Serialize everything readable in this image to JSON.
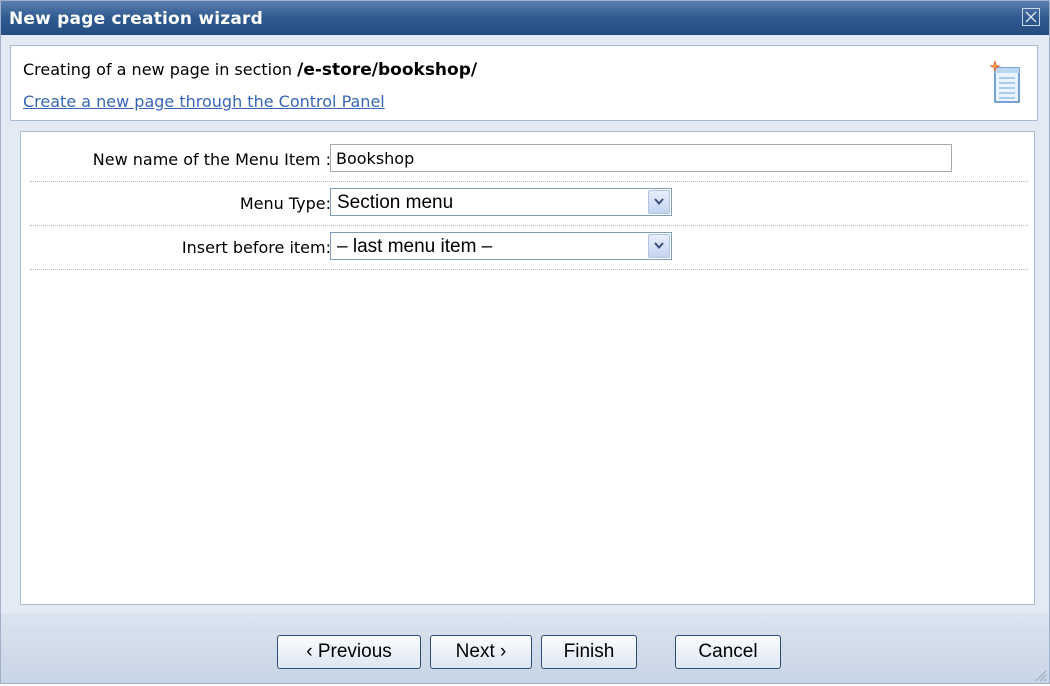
{
  "window": {
    "title": "New page creation wizard",
    "close_icon": "close-icon"
  },
  "header": {
    "text_prefix": "Creating of a new page in section",
    "section_path": "/e-store/bookshop/",
    "link_label": "Create a new page through the Control Panel",
    "icon": "new-document-icon"
  },
  "form": {
    "menu_item_name": {
      "label": "New name of the Menu Item :",
      "value": "Bookshop"
    },
    "menu_type": {
      "label": "Menu Type:",
      "value": "Section menu"
    },
    "insert_before": {
      "label": "Insert before item:",
      "value": "– last menu item –"
    }
  },
  "buttons": {
    "previous": "‹ Previous",
    "next": "Next ›",
    "finish": "Finish",
    "cancel": "Cancel"
  }
}
